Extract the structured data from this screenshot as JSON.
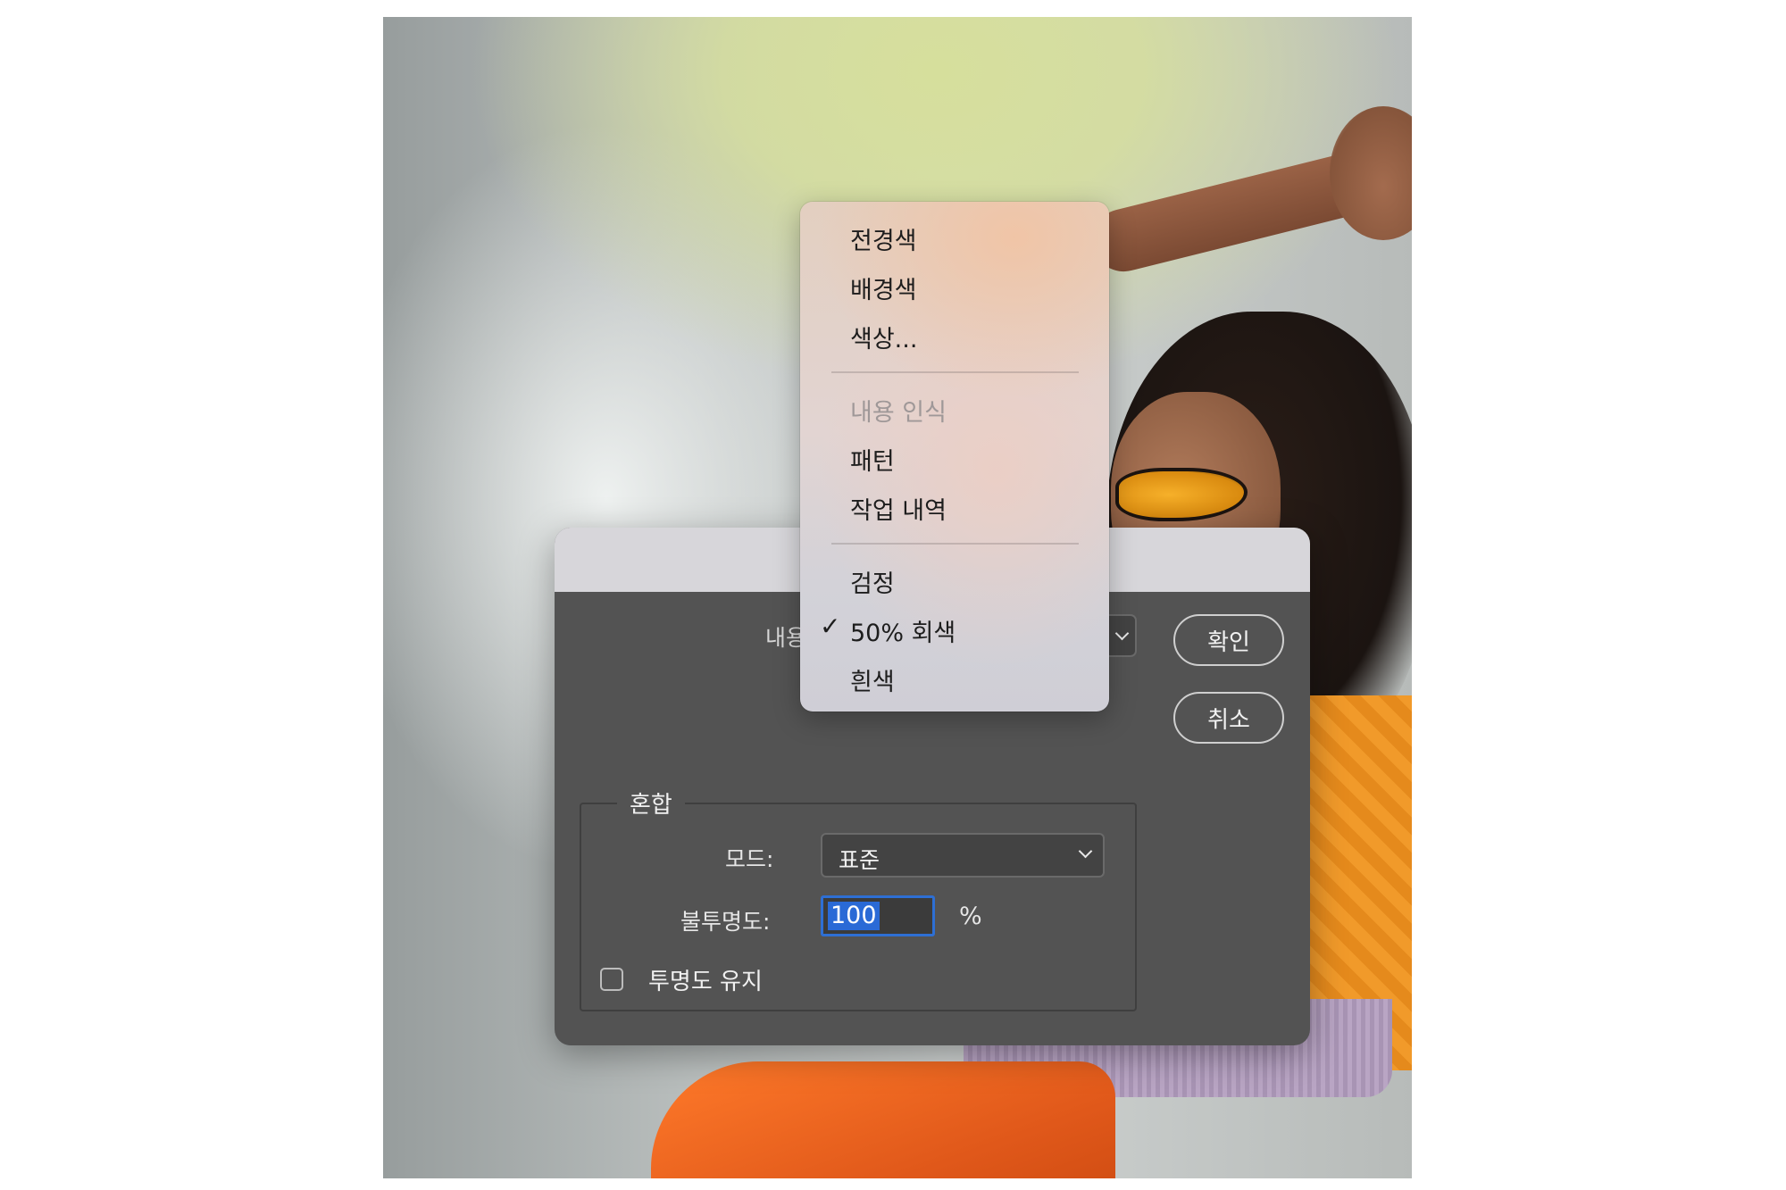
{
  "dialog": {
    "content_label": "내용",
    "ok_button": "확인",
    "cancel_button": "취소",
    "blend_group": {
      "title": "혼합",
      "mode_label": "모드:",
      "mode_value": "표준",
      "opacity_label": "불투명도:",
      "opacity_value": "100",
      "opacity_unit": "%",
      "preserve_transparency_label": "투명도 유지",
      "preserve_transparency_checked": false
    }
  },
  "content_menu": {
    "items": [
      {
        "label": "전경색",
        "enabled": true,
        "checked": false
      },
      {
        "label": "배경색",
        "enabled": true,
        "checked": false
      },
      {
        "label": "색상...",
        "enabled": true,
        "checked": false
      },
      {
        "label": "내용 인식",
        "enabled": false,
        "checked": false
      },
      {
        "label": "패턴",
        "enabled": true,
        "checked": false
      },
      {
        "label": "작업 내역",
        "enabled": true,
        "checked": false
      },
      {
        "label": "검정",
        "enabled": true,
        "checked": false
      },
      {
        "label": "50% 회색",
        "enabled": true,
        "checked": true
      },
      {
        "label": "흰색",
        "enabled": true,
        "checked": false
      }
    ],
    "check_mark": "✓"
  },
  "colors": {
    "dialog_bg": "#535353",
    "titlebar_bg": "#d7d6da",
    "focus_ring": "#2e6fd4",
    "selection_bg": "#2a6ad6"
  }
}
